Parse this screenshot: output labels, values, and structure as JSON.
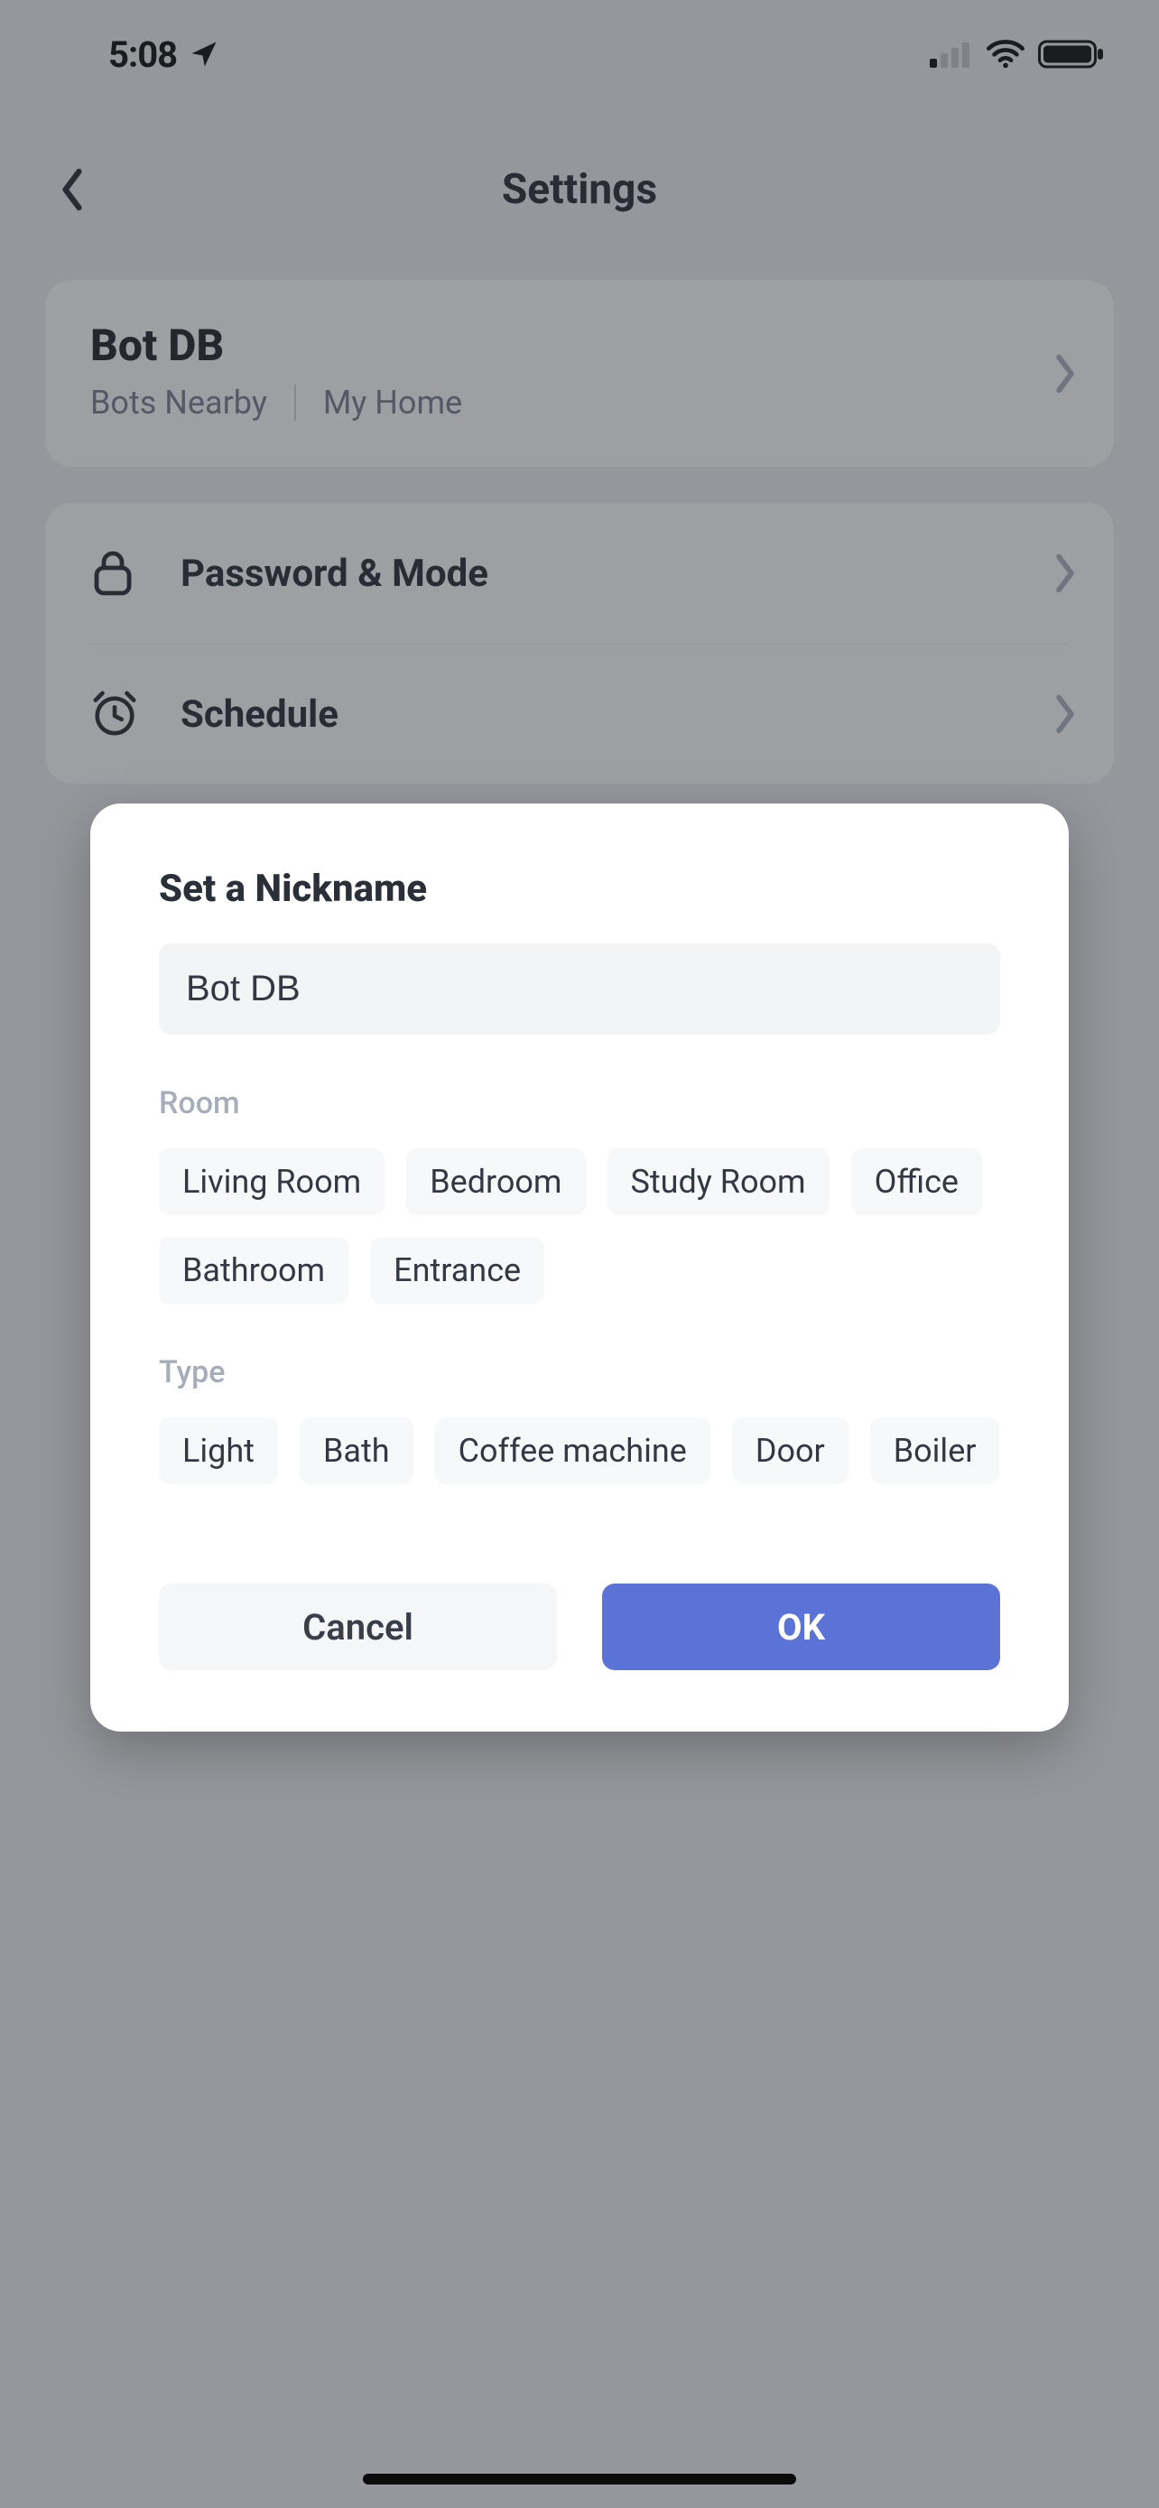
{
  "status": {
    "time": "5:08"
  },
  "header": {
    "title": "Settings"
  },
  "device": {
    "name": "Bot DB",
    "subgroup_a": "Bots Nearby",
    "subgroup_b": "My Home"
  },
  "menu": {
    "password": "Password & Mode",
    "schedule": "Schedule"
  },
  "dialog": {
    "title": "Set a Nickname",
    "nickname_value": "Bot DB",
    "room_label": "Room",
    "rooms": [
      "Living Room",
      "Bedroom",
      "Study Room",
      "Office",
      "Bathroom",
      "Entrance"
    ],
    "type_label": "Type",
    "types": [
      "Light",
      "Bath",
      "Coffee machine",
      "Door",
      "Boiler"
    ],
    "cancel": "Cancel",
    "ok": "OK"
  }
}
